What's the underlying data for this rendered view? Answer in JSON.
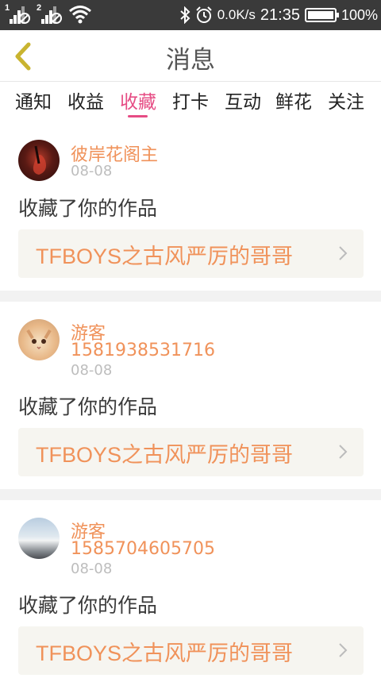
{
  "status_bar": {
    "sim1": "1",
    "sim2": "2",
    "speed": "0.0K/s",
    "time": "21:35",
    "battery": "100%"
  },
  "header": {
    "title": "消息"
  },
  "tabs": [
    "通知",
    "收益",
    "收藏",
    "打卡",
    "互动",
    "鲜花",
    "关注"
  ],
  "active_tab": "收藏",
  "accent_color": "#e64c84",
  "name_color": "#f0925a",
  "messages": [
    {
      "name": "彼岸花阁主",
      "phone": "",
      "date": "08-08",
      "action": "收藏了你的作品",
      "work": "TFBOYS之古风严厉的哥哥"
    },
    {
      "name": "游客",
      "phone": "1581938531716",
      "date": "08-08",
      "action": "收藏了你的作品",
      "work": "TFBOYS之古风严厉的哥哥"
    },
    {
      "name": "游客",
      "phone": "1585704605705",
      "date": "08-08",
      "action": "收藏了你的作品",
      "work": "TFBOYS之古风严厉的哥哥"
    }
  ]
}
